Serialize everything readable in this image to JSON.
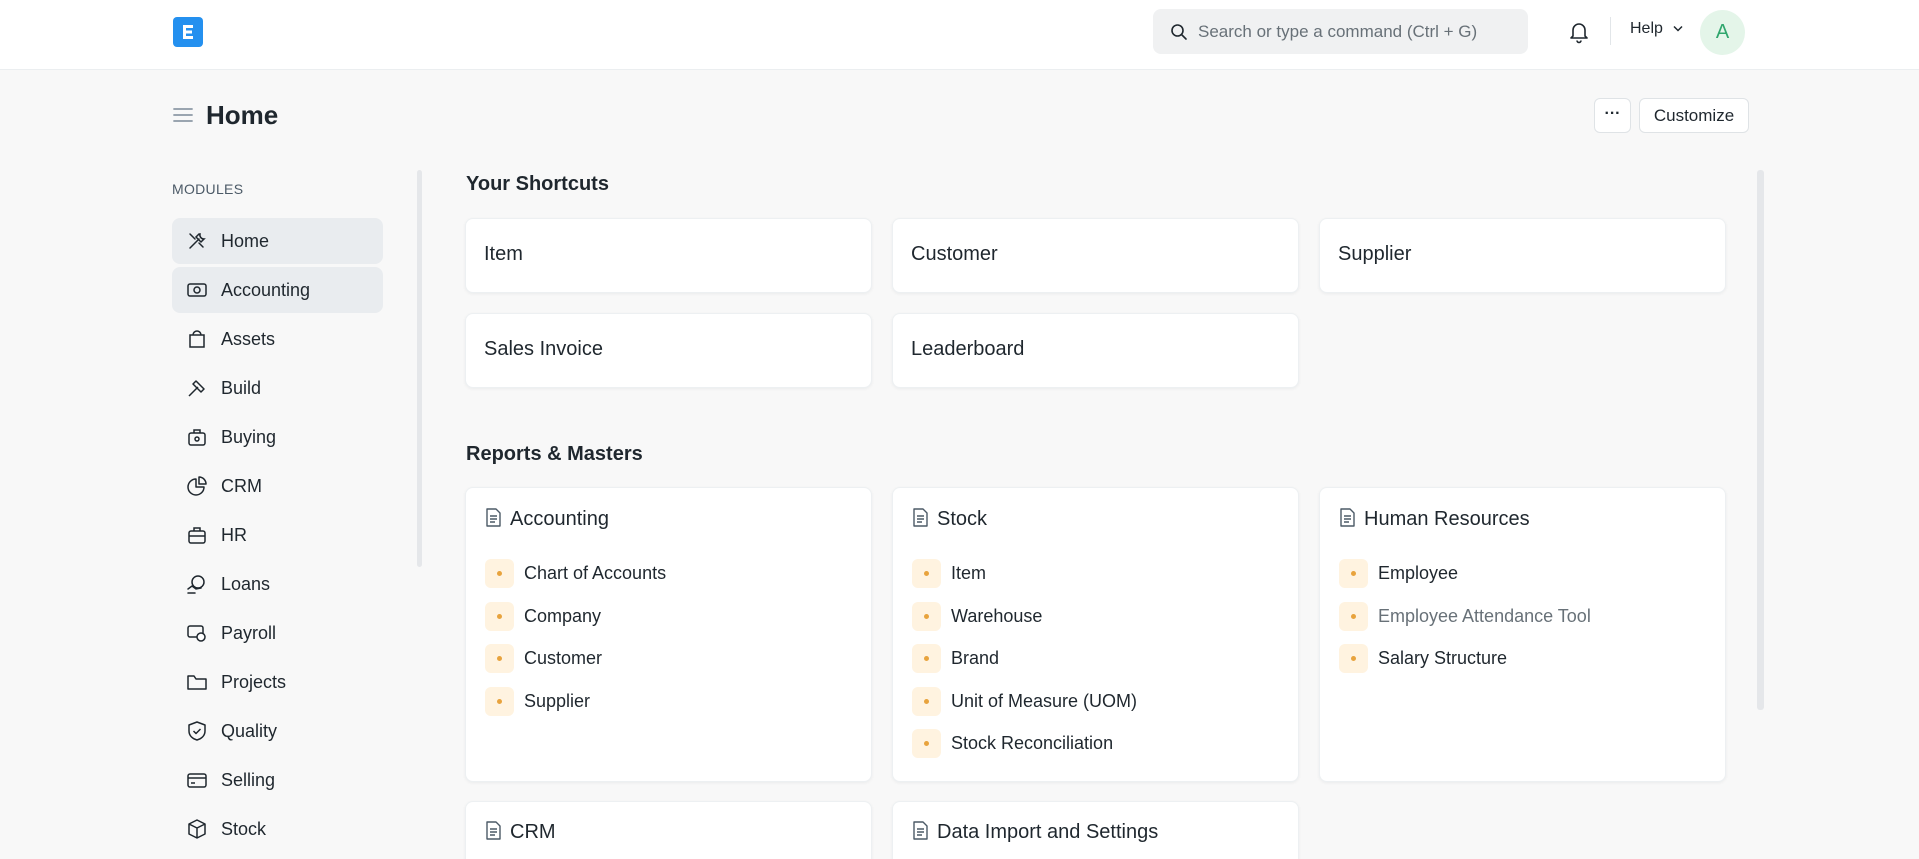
{
  "navbar": {
    "search_placeholder": "Search or type a command (Ctrl + G)",
    "help_label": "Help",
    "avatar_initial": "A"
  },
  "page": {
    "title": "Home",
    "more_label": "···",
    "customize_label": "Customize"
  },
  "sidebar": {
    "section_label": "MODULES",
    "items": [
      {
        "label": "Home",
        "icon": "tools-icon"
      },
      {
        "label": "Accounting",
        "icon": "money-icon"
      },
      {
        "label": "Assets",
        "icon": "bag-icon"
      },
      {
        "label": "Build",
        "icon": "hammer-icon"
      },
      {
        "label": "Buying",
        "icon": "buying-icon"
      },
      {
        "label": "CRM",
        "icon": "pie-chart-icon"
      },
      {
        "label": "HR",
        "icon": "briefcase-icon"
      },
      {
        "label": "Loans",
        "icon": "loan-icon"
      },
      {
        "label": "Payroll",
        "icon": "payroll-icon"
      },
      {
        "label": "Projects",
        "icon": "folder-icon"
      },
      {
        "label": "Quality",
        "icon": "shield-icon"
      },
      {
        "label": "Selling",
        "icon": "card-icon"
      },
      {
        "label": "Stock",
        "icon": "box-icon"
      }
    ]
  },
  "shortcuts": {
    "title": "Your Shortcuts",
    "items": [
      "Item",
      "Customer",
      "Supplier",
      "Sales Invoice",
      "Leaderboard"
    ]
  },
  "reports": {
    "title": "Reports & Masters",
    "cards": [
      {
        "title": "Accounting",
        "links": [
          "Chart of Accounts",
          "Company",
          "Customer",
          "Supplier"
        ]
      },
      {
        "title": "Stock",
        "links": [
          "Item",
          "Warehouse",
          "Brand",
          "Unit of Measure (UOM)",
          "Stock Reconciliation"
        ]
      },
      {
        "title": "Human Resources",
        "links": [
          "Employee",
          "Employee Attendance Tool",
          "Salary Structure"
        ]
      },
      {
        "title": "CRM",
        "links": []
      },
      {
        "title": "Data Import and Settings",
        "links": []
      }
    ]
  },
  "colors": {
    "brand": "#2490ef",
    "link_dot": "#e8a33d",
    "active_bg": "#e9ecef"
  }
}
